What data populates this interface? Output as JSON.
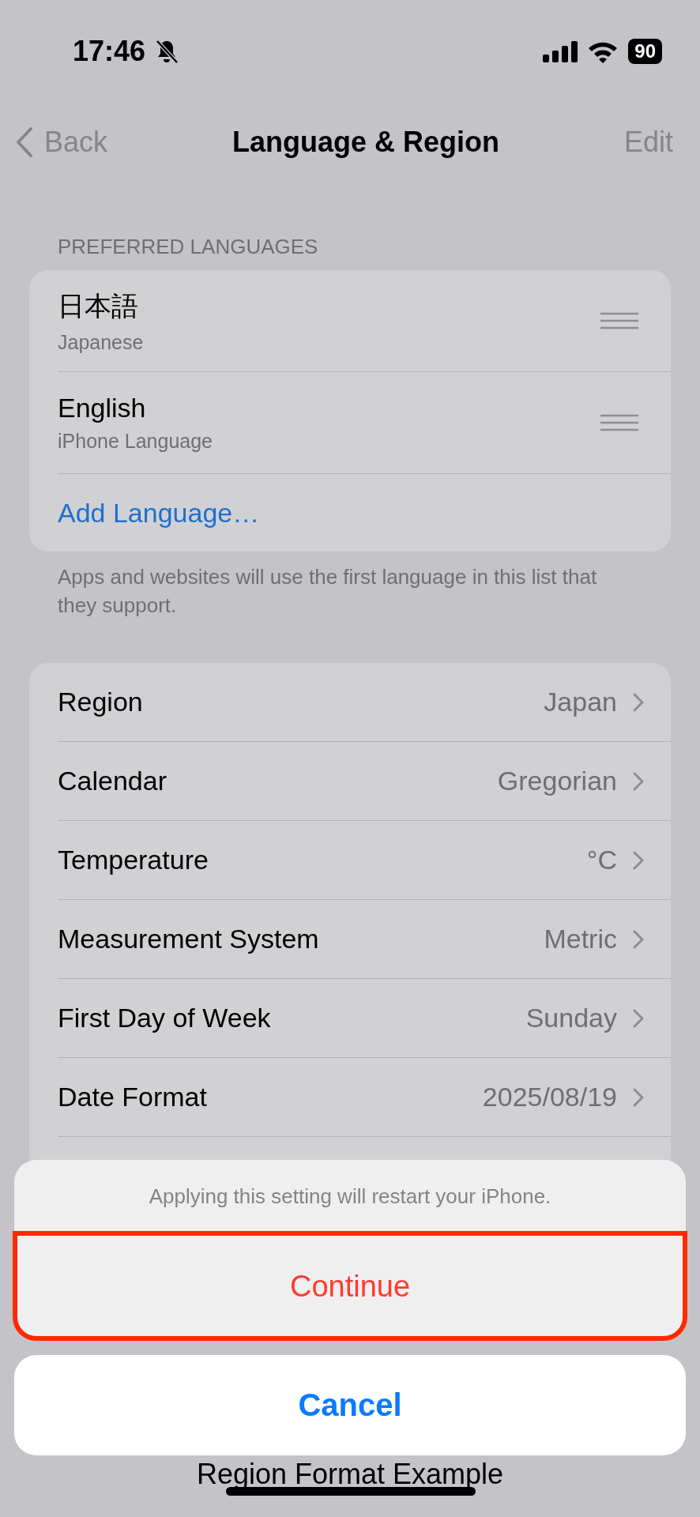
{
  "status_bar": {
    "time": "17:46",
    "battery": "90"
  },
  "nav": {
    "back": "Back",
    "title": "Language & Region",
    "edit": "Edit"
  },
  "preferred_languages": {
    "header": "PREFERRED LANGUAGES",
    "languages": [
      {
        "name": "日本語",
        "subtitle": "Japanese"
      },
      {
        "name": "English",
        "subtitle": "iPhone Language"
      }
    ],
    "add": "Add Language…",
    "footer": "Apps and websites will use the first language in this list that they support."
  },
  "settings": [
    {
      "label": "Region",
      "value": "Japan"
    },
    {
      "label": "Calendar",
      "value": "Gregorian"
    },
    {
      "label": "Temperature",
      "value": "°C"
    },
    {
      "label": "Measurement System",
      "value": "Metric"
    },
    {
      "label": "First Day of Week",
      "value": "Sunday"
    },
    {
      "label": "Date Format",
      "value": "2025/08/19"
    }
  ],
  "region_format": {
    "title": "Region Format Example"
  },
  "action_sheet": {
    "message": "Applying this setting will restart your iPhone.",
    "actions": [
      {
        "label": "Continue",
        "kind": "destructive",
        "highlighted": true
      }
    ],
    "cancel": "Cancel"
  }
}
